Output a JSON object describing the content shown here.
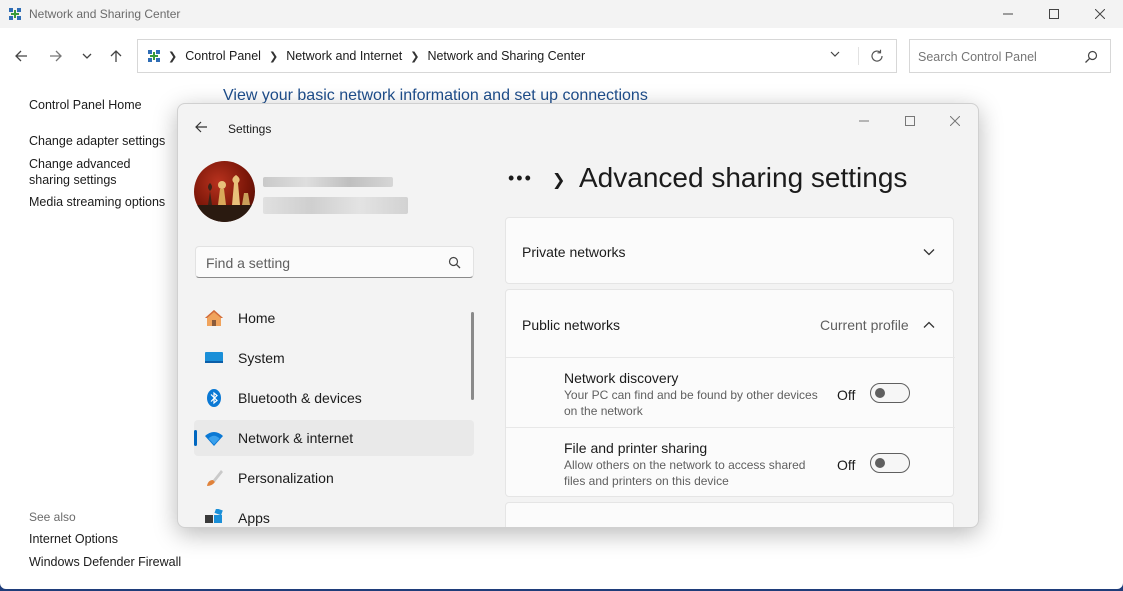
{
  "window": {
    "title": "Network and Sharing Center"
  },
  "address_bar": {
    "crumbs": [
      "Control Panel",
      "Network and Internet",
      "Network and Sharing Center"
    ]
  },
  "search": {
    "placeholder": "Search Control Panel"
  },
  "left_pane": {
    "links": [
      "Control Panel Home",
      "Change adapter settings",
      "Change advanced sharing settings",
      "Media streaming options"
    ],
    "see_also_label": "See also",
    "see_also_links": [
      "Internet Options",
      "Windows Defender Firewall"
    ]
  },
  "main": {
    "heading": "View your basic network information and set up connections"
  },
  "settings": {
    "title": "Settings",
    "find_placeholder": "Find a setting",
    "nav": [
      {
        "label": "Home",
        "icon": "home-icon"
      },
      {
        "label": "System",
        "icon": "system-icon"
      },
      {
        "label": "Bluetooth & devices",
        "icon": "bluetooth-icon"
      },
      {
        "label": "Network & internet",
        "icon": "wifi-icon",
        "active": true
      },
      {
        "label": "Personalization",
        "icon": "brush-icon"
      },
      {
        "label": "Apps",
        "icon": "apps-icon"
      }
    ],
    "breadcrumb_more": "•••",
    "page_title": "Advanced sharing settings",
    "private_networks": "Private networks",
    "public_networks": {
      "label": "Public networks",
      "current_profile": "Current profile",
      "rows": [
        {
          "title": "Network discovery",
          "desc": "Your PC can find and be found by other devices on the network",
          "state": "Off"
        },
        {
          "title": "File and printer sharing",
          "desc": "Allow others on the network to access shared files and printers on this device",
          "state": "Off"
        }
      ]
    }
  },
  "colors": {
    "accent": "#0067c0",
    "link_heading": "#1e4e8c",
    "desktop": "#1f3d7a"
  }
}
